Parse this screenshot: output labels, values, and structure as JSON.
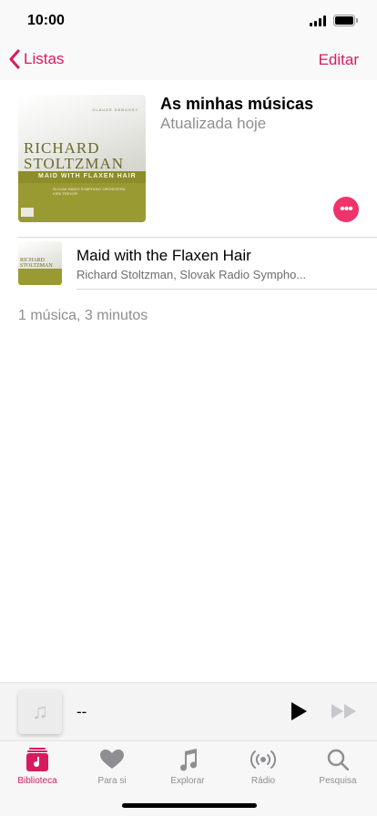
{
  "status_bar": {
    "time": "10:00"
  },
  "nav": {
    "back_label": "Listas",
    "edit_label": "Editar"
  },
  "playlist": {
    "title": "As minhas músicas",
    "subtitle": "Atualizada hoje",
    "cover": {
      "composer": "CLAUDE DEBUSSY",
      "artist_line1": "RICHARD",
      "artist_line2": "STOLTZMAN",
      "work": "MAID WITH FLAXEN HAIR",
      "orchestra_line1": "SLOVAK RADIO SYMPHONY ORCHESTRA",
      "orchestra_line2": "KIRK TREVOR"
    },
    "more_label": "•••"
  },
  "tracks": [
    {
      "title": "Maid with the Flaxen Hair",
      "artist": "Richard Stoltzman, Slovak Radio Sympho..."
    }
  ],
  "summary": "1 música, 3 minutos",
  "mini_player": {
    "title": "--"
  },
  "tabs": [
    {
      "label": "Biblioteca",
      "icon": "library-icon",
      "active": true
    },
    {
      "label": "Para si",
      "icon": "heart-icon",
      "active": false
    },
    {
      "label": "Explorar",
      "icon": "music-note-icon",
      "active": false
    },
    {
      "label": "Rádio",
      "icon": "radio-icon",
      "active": false
    },
    {
      "label": "Pesquisa",
      "icon": "search-icon",
      "active": false
    }
  ],
  "colors": {
    "accent": "#d81b60",
    "more_button": "#f0336b",
    "inactive": "#8e8e93"
  }
}
